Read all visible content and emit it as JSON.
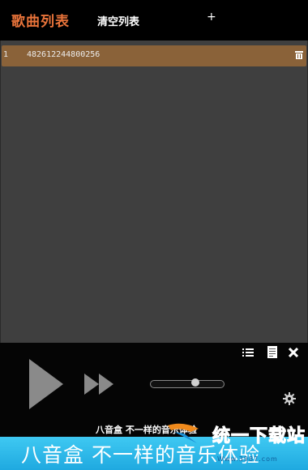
{
  "header": {
    "title": "歌曲列表",
    "clear_label": "清空列表",
    "add_label": "+"
  },
  "playlist": {
    "items": [
      {
        "index": "1",
        "name": "482612244800256"
      }
    ]
  },
  "controls": {
    "progress": 0.62
  },
  "slogan": {
    "small": "八音盒 不一样的音乐体验",
    "banner": "八音盒  不一样的音乐体验"
  },
  "watermark": {
    "text": "统一下载站",
    "sub": "Www.3987.com"
  },
  "colors": {
    "title": "#e8733a",
    "row_highlight": "#8a6239",
    "list_bg": "#3f3f3f",
    "banner": "#3fc9f2"
  },
  "icons": [
    "trash-icon",
    "play-icon",
    "fast-forward-icon",
    "list-icon",
    "lyrics-icon",
    "close-icon",
    "gear-icon"
  ]
}
